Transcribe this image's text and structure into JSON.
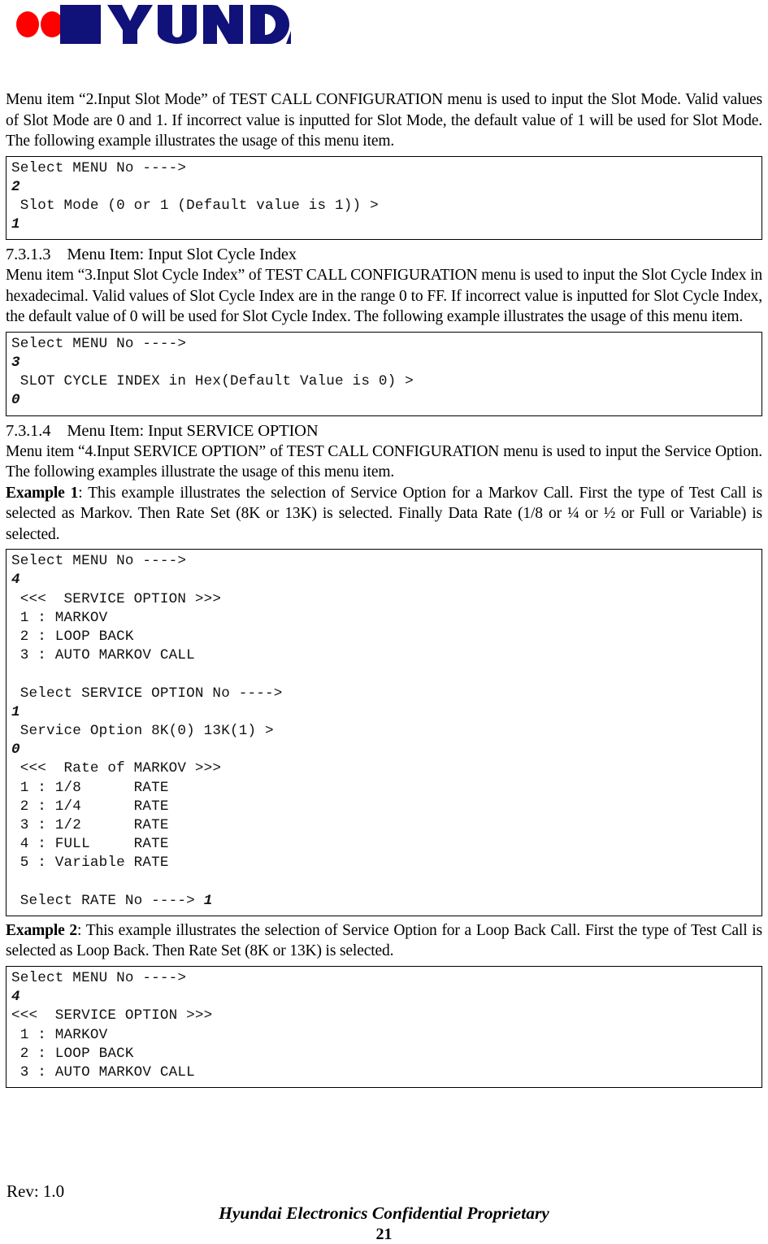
{
  "logo": {
    "brand_text": "HYUNDAI",
    "navy_color": "#11117a",
    "red_color": "#fe0000",
    "alt": "Hyundai logo"
  },
  "body": {
    "para_slot_mode": "Menu item “2.Input Slot Mode” of TEST CALL CONFIGURATION menu is used to input the Slot Mode. Valid values of Slot Mode are 0 and 1. If incorrect value is inputted for Slot Mode, the default value of 1 will be used for Slot Mode. The following example illustrates the usage of this menu item.",
    "code_slot_mode": {
      "lines": [
        {
          "text": "Select MENU No ---->",
          "bold": false
        },
        {
          "text": "2",
          "bold": true
        },
        {
          "text": " Slot Mode (0 or 1 (Default value is 1)) >",
          "bold": false
        },
        {
          "text": "1",
          "bold": true
        }
      ]
    },
    "section_7313": {
      "number": "7.3.1.3",
      "title": "Menu Item: Input Slot Cycle Index",
      "paragraph": "Menu item “3.Input Slot Cycle Index” of TEST CALL CONFIGURATION menu is used to input the Slot Cycle Index in hexadecimal. Valid values of Slot Cycle Index are in the range 0 to FF. If incorrect value is inputted for Slot Cycle Index, the default value of 0 will be used for Slot Cycle Index. The following example illustrates the usage of this menu item."
    },
    "code_slot_cycle": {
      "lines": [
        {
          "text": "Select MENU No ---->",
          "bold": false
        },
        {
          "text": "3",
          "bold": true
        },
        {
          "text": " SLOT CYCLE INDEX in Hex(Default Value is 0) >",
          "bold": false
        },
        {
          "text": "0",
          "bold": true
        }
      ]
    },
    "section_7314": {
      "number": "7.3.1.4",
      "title": "Menu Item: Input SERVICE OPTION",
      "paragraph": "Menu item “4.Input SERVICE OPTION” of TEST CALL CONFIGURATION menu is used to input the Service Option. The following examples illustrate the usage of this menu item.",
      "example1_label": "Example 1",
      "example1_text": ": This example illustrates the selection of Service Option for a Markov Call. First the type of Test Call is selected as Markov. Then Rate Set (8K or 13K) is selected. Finally Data Rate (1/8 or ¼ or ½ or Full or Variable) is selected.",
      "example2_label": "Example 2",
      "example2_text": ": This example illustrates the selection of Service Option for a Loop Back Call. First the type of Test Call is selected as Loop Back. Then Rate Set (8K or 13K) is selected."
    },
    "code_example1": {
      "lines": [
        {
          "text": "Select MENU No ---->",
          "bold": false
        },
        {
          "text": "4",
          "bold": true
        },
        {
          "text": " <<<  SERVICE OPTION >>>",
          "bold": false
        },
        {
          "text": " 1 : MARKOV",
          "bold": false
        },
        {
          "text": " 2 : LOOP BACK",
          "bold": false
        },
        {
          "text": " 3 : AUTO MARKOV CALL",
          "bold": false
        },
        {
          "text": "",
          "bold": false
        },
        {
          "text": " Select SERVICE OPTION No ---->",
          "bold": false
        },
        {
          "text": "1",
          "bold": true
        },
        {
          "text": " Service Option 8K(0) 13K(1) >",
          "bold": false
        },
        {
          "text": "0",
          "bold": true
        },
        {
          "text": " <<<  Rate of MARKOV >>>",
          "bold": false
        },
        {
          "text": " 1 : 1/8      RATE",
          "bold": false
        },
        {
          "text": " 2 : 1/4      RATE",
          "bold": false
        },
        {
          "text": " 3 : 1/2      RATE",
          "bold": false
        },
        {
          "text": " 4 : FULL     RATE",
          "bold": false
        },
        {
          "text": " 5 : Variable RATE",
          "bold": false
        },
        {
          "text": "",
          "bold": false
        },
        {
          "prefix": " Select RATE No ----> ",
          "value": "1"
        }
      ]
    },
    "code_example2": {
      "lines": [
        {
          "text": "Select MENU No ---->",
          "bold": false
        },
        {
          "text": "4",
          "bold": true
        },
        {
          "text": "<<<  SERVICE OPTION >>>",
          "bold": false
        },
        {
          "text": " 1 : MARKOV",
          "bold": false
        },
        {
          "text": " 2 : LOOP BACK",
          "bold": false
        },
        {
          "text": " 3 : AUTO MARKOV CALL",
          "bold": false
        }
      ]
    }
  },
  "footer": {
    "rev": "Rev: 1.0",
    "confidential": "Hyundai Electronics Confidential Proprietary",
    "page_number": "21"
  }
}
